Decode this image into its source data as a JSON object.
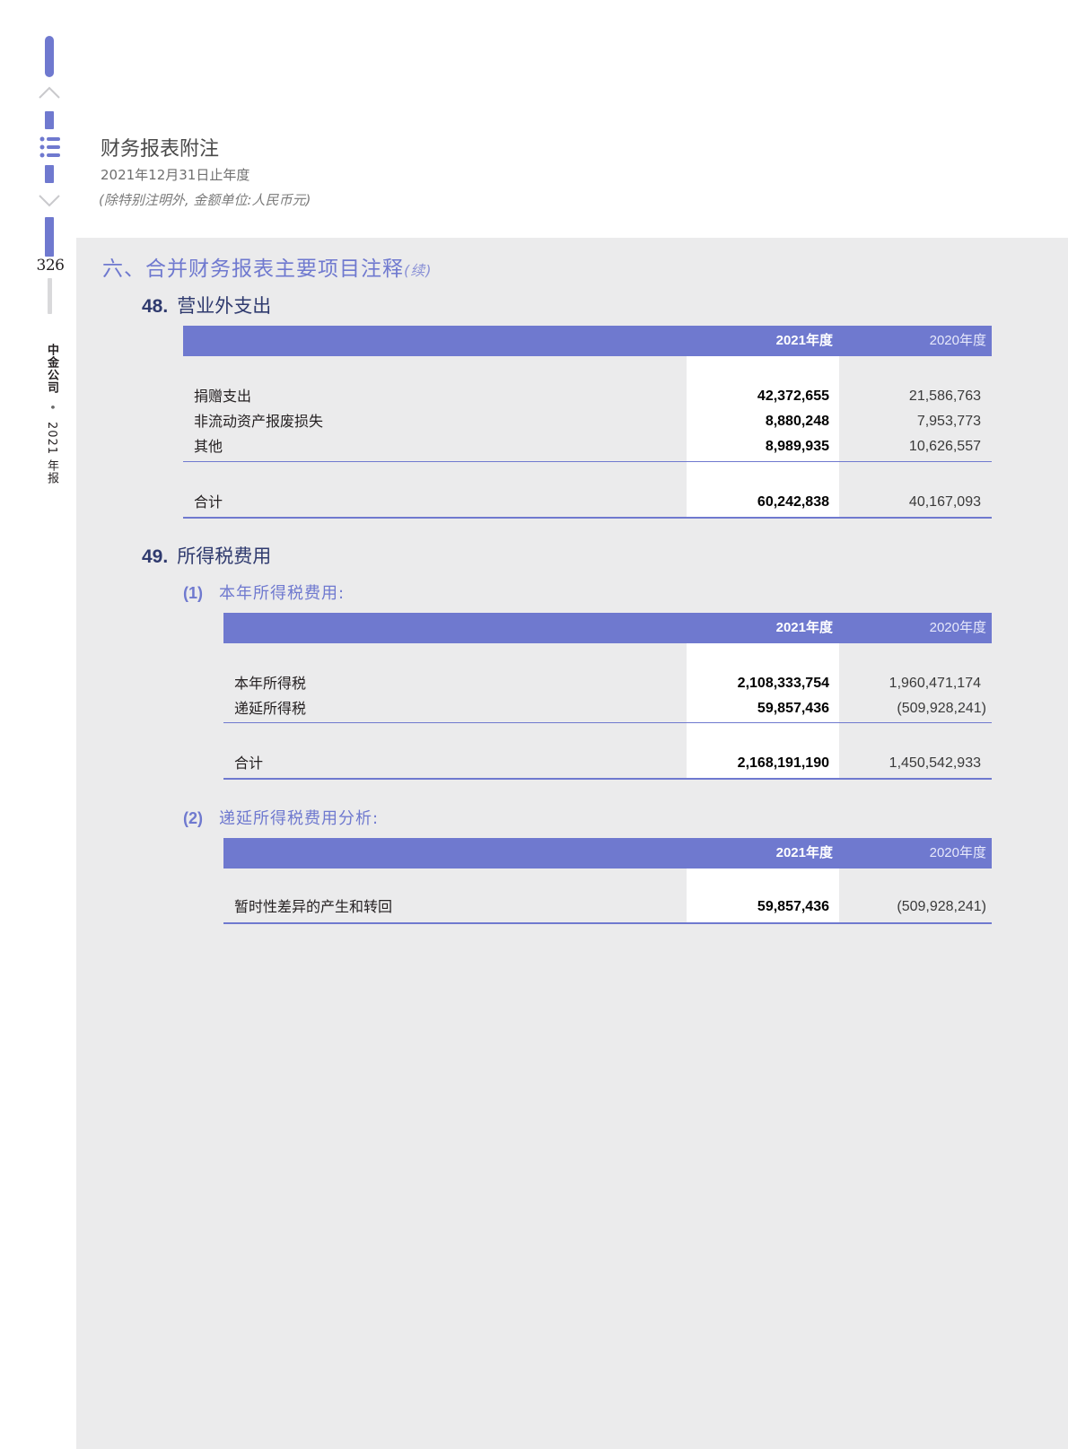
{
  "rail": {
    "page_number": "326",
    "company": "中金公司",
    "separator": "•",
    "year_report": "2021 年报"
  },
  "header": {
    "title": "财务报表附注",
    "period": "2021年12月31日止年度",
    "unit_note": "(除特别注明外, 金额单位:人民币元)"
  },
  "section": {
    "title": "六、合并财务报表主要项目注释",
    "continued": "(续)"
  },
  "note48": {
    "number": "48.",
    "title": "营业外支出",
    "col_current": "2021年度",
    "col_prior": "2020年度",
    "rows": [
      {
        "label": "捐赠支出",
        "current": "42,372,655",
        "prior": "21,586,763"
      },
      {
        "label": "非流动资产报废损失",
        "current": "8,880,248",
        "prior": "7,953,773"
      },
      {
        "label": "其他",
        "current": "8,989,935",
        "prior": "10,626,557"
      }
    ],
    "total": {
      "label": "合计",
      "current": "60,242,838",
      "prior": "40,167,093"
    }
  },
  "note49": {
    "number": "49.",
    "title": "所得税费用",
    "part1": {
      "number": "(1)",
      "title": "本年所得税费用:",
      "col_current": "2021年度",
      "col_prior": "2020年度",
      "rows": [
        {
          "label": "本年所得税",
          "current": "2,108,333,754",
          "prior": "1,960,471,174"
        },
        {
          "label": "递延所得税",
          "current": "59,857,436",
          "prior": "(509,928,241)"
        }
      ],
      "total": {
        "label": "合计",
        "current": "2,168,191,190",
        "prior": "1,450,542,933"
      }
    },
    "part2": {
      "number": "(2)",
      "title": "递延所得税费用分析:",
      "col_current": "2021年度",
      "col_prior": "2020年度",
      "rows": [
        {
          "label": "暂时性差异的产生和转回",
          "current": "59,857,436",
          "prior": "(509,928,241)"
        }
      ]
    }
  },
  "colors": {
    "accent": "#6f79cf",
    "heading_dark": "#2f3a6e",
    "panel": "#ebebec"
  }
}
